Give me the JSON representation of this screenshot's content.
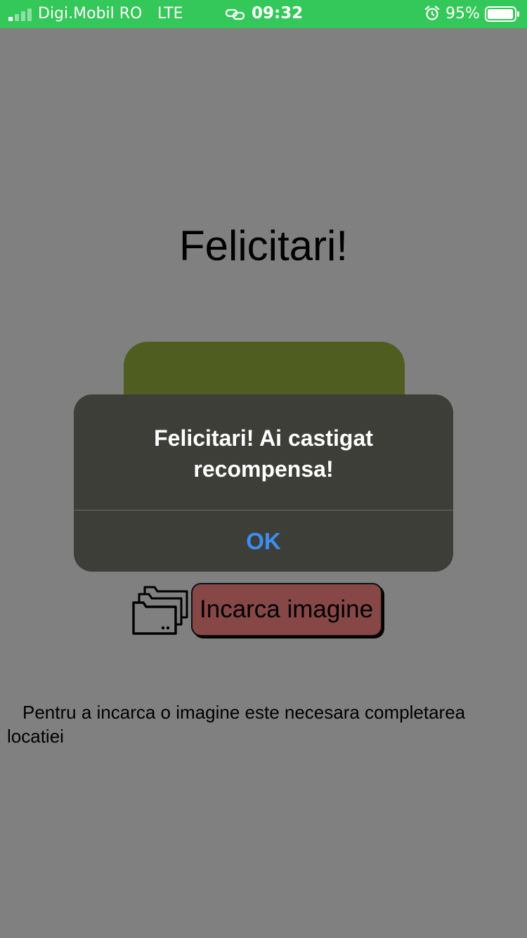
{
  "status_bar": {
    "carrier": "Digi.Mobil RO",
    "network": "LTE",
    "time": "09:32",
    "battery": "95%",
    "signal_bars_active": 1,
    "signal_bars_total": 4,
    "battery_level": 0.95,
    "icons": [
      "signal-icon",
      "link-icon",
      "alarm-icon",
      "battery-icon"
    ],
    "background_color": "#34c759"
  },
  "main": {
    "title": "Felicitari!",
    "upload_button_label": "Incarca imagine",
    "upload_icon": "folder-icon",
    "helper_text": "Pentru a incarca o imagine este necesara completarea locatiei"
  },
  "alert": {
    "message": "Felicitari! Ai castigat recompensa!",
    "ok_label": "OK"
  },
  "colors": {
    "background": "#808080",
    "green_card": "#4f5e20",
    "upload_button": "#874747",
    "alert_background": "#3d3e38",
    "alert_button_text": "#3d8df2"
  }
}
